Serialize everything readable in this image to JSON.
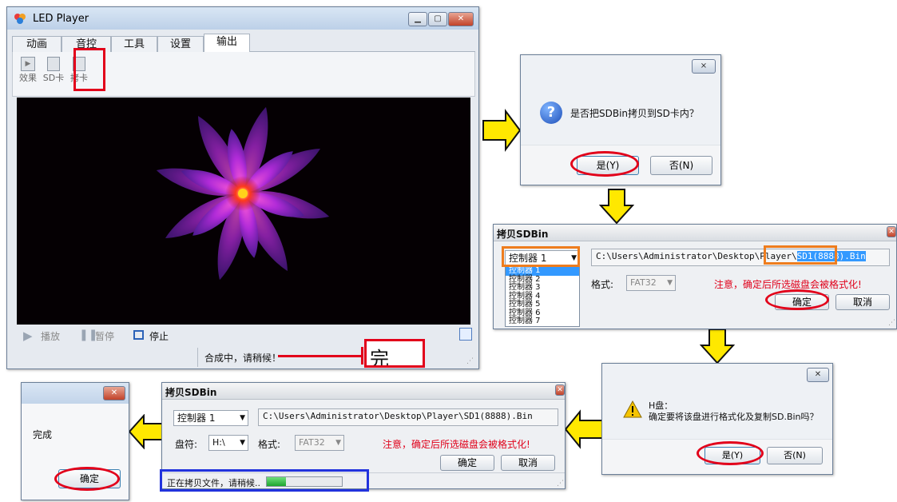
{
  "colors": {
    "arrow_fill": "#ffe800",
    "arrow_stroke": "#111111",
    "highlight_red": "#e2001a",
    "highlight_orange": "#ee7d1e",
    "highlight_blue": "#2233dd"
  },
  "led_player": {
    "title": "LED Player",
    "menu_tabs": [
      "动画",
      "音控",
      "工具",
      "设置",
      "输出"
    ],
    "active_tab": "输出",
    "toolbar": {
      "effect": "效果",
      "sd_card": "SD卡",
      "copy_card": "拷卡"
    },
    "controls": {
      "play": "播放",
      "pause": "暂停",
      "stop": "停止"
    },
    "status": "合成中，请稍候！",
    "annotation": "完成！"
  },
  "confirm_dialog": {
    "close": "⨯",
    "message": "是否把SDBin拷贝到SD卡内？",
    "yes": "是(Y)",
    "no": "否(N)",
    "icon": "question-icon"
  },
  "copy_dialog_1": {
    "title": "拷贝SDBin",
    "controller_selected": "控制器 1",
    "controller_options": [
      "控制器 1",
      "控制器 2",
      "控制器 3",
      "控制器 4",
      "控制器 5",
      "控制器 6",
      "控制器 7"
    ],
    "path_prefix": "C:\\Users\\Administrator\\Desktop\\Player\\",
    "path_file": "SD1(8888).Bin",
    "format_label": "格式:",
    "format_value": "FAT32",
    "warning": "注意，确定后所选磁盘会被格式化!",
    "ok": "确定",
    "cancel": "取消"
  },
  "format_dialog": {
    "drive": "H盘：",
    "message": "确定要将该盘进行格式化及复制SD.Bin吗？",
    "yes": "是(Y)",
    "no": "否(N)",
    "icon": "warning-icon"
  },
  "copy_dialog_2": {
    "title": "拷贝SDBin",
    "controller_selected": "控制器 1",
    "path": "C:\\Users\\Administrator\\Desktop\\Player\\SD1(8888).Bin",
    "drive_label": "盘符:",
    "drive_value": "H:\\",
    "format_label": "格式:",
    "format_value": "FAT32",
    "warning": "注意，确定后所选磁盘会被格式化!",
    "ok": "确定",
    "cancel": "取消",
    "status": "正在拷贝文件，请稍候..",
    "progress": 0.25
  },
  "done_dialog": {
    "message": "完成",
    "ok": "确定"
  }
}
